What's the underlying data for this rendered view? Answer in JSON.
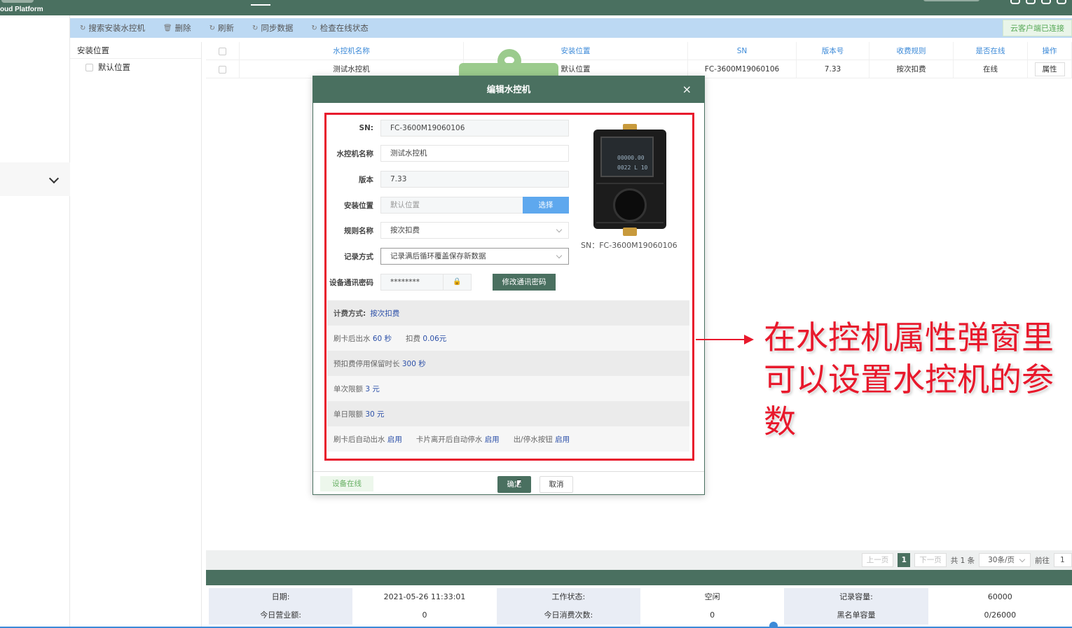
{
  "app": {
    "brand": "oud Platform"
  },
  "toolbar": {
    "buttons": [
      {
        "label": "搜索安装水控机",
        "icon": "refresh-icon"
      },
      {
        "label": "删除",
        "icon": "trash-icon"
      },
      {
        "label": "刷新",
        "icon": "refresh-icon"
      },
      {
        "label": "同步数据",
        "icon": "refresh-icon"
      },
      {
        "label": "检查在线状态",
        "icon": "refresh-icon"
      }
    ],
    "client_status": "云客户端已连接"
  },
  "tree": {
    "header": "安装位置",
    "items": [
      "默认位置"
    ]
  },
  "table": {
    "headers": [
      "水控机名称",
      "安装位置",
      "SN",
      "版本号",
      "收费规则",
      "是否在线",
      "操作"
    ],
    "rows": [
      {
        "name": "测试水控机",
        "location": "默认位置",
        "sn": "FC-3600M19060106",
        "version": "7.33",
        "rule": "按次扣费",
        "online": "在线",
        "action": "属性"
      }
    ]
  },
  "pager": {
    "prev": "上一页",
    "current": "1",
    "next": "下一页",
    "total": "共 1 条",
    "per_page": "30条/页",
    "goto_label": "前往",
    "goto_value": "1"
  },
  "status": {
    "rows": [
      [
        "日期:",
        "2021-05-26 11:33:01",
        "工作状态:",
        "空闲",
        "记录容量:",
        "60000"
      ],
      [
        "今日营业额:",
        "0",
        "今日消费次数:",
        "0",
        "黑名单容量",
        "0/26000"
      ]
    ]
  },
  "modal": {
    "title": "编辑水控机",
    "close": "×",
    "fields": {
      "sn_label": "SN:",
      "sn_value": "FC-3600M19060106",
      "name_label": "水控机名称",
      "name_value": "测试水控机",
      "version_label": "版本",
      "version_value": "7.33",
      "location_label": "安装位置",
      "location_placeholder": "默认位置",
      "choose_btn": "选择",
      "rule_label": "规则名称",
      "rule_value": "按次扣费",
      "record_label": "记录方式",
      "record_value": "记录满后循环覆盖保存新数据",
      "pwd_label": "设备通讯密码",
      "pwd_value": "********",
      "pwd_btn": "修改通讯密码"
    },
    "device": {
      "screen_amount": "00000.00",
      "screen_code": "0022 L 10",
      "sn_caption": "SN：FC-3600M19060106"
    },
    "billing": {
      "method_label": "计费方式:",
      "method_value": "按次扣费",
      "swipe_label": "刷卡后出水",
      "swipe_value": "60 秒",
      "deduct_label": "扣费",
      "deduct_value": "0.06元",
      "hold_label": "预扣费停用保留时长",
      "hold_value": "300 秒",
      "single_label": "单次限额",
      "single_value": "3 元",
      "daily_label": "单日限额",
      "daily_value": "30 元",
      "auto_out_label": "刷卡后自动出水",
      "auto_out_value": "启用",
      "auto_stop_label": "卡片离开后自动停水",
      "auto_stop_value": "启用",
      "button_label": "出/停水按钮",
      "button_value": "启用"
    },
    "footer": {
      "online": "设备在线",
      "ok": "确定",
      "cancel": "取消"
    }
  },
  "annotation": {
    "text": "在水控机属性弹窗里可以设置水控机的参数"
  },
  "colors": {
    "primary": "#4a7060",
    "toolbar": "#bcd9f3",
    "highlight": "#e8192c",
    "link": "#3c8ad8"
  }
}
